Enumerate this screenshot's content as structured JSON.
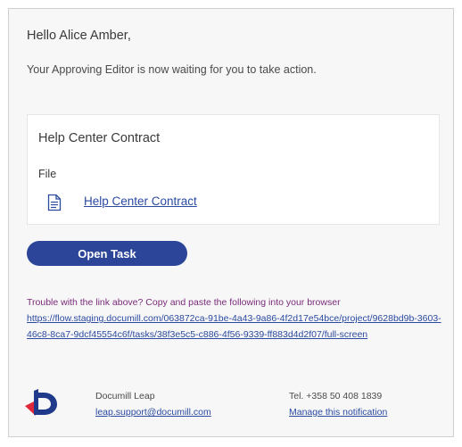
{
  "email": {
    "greeting": "Hello Alice Amber,",
    "message": "Your Approving Editor is now waiting for you to take action.",
    "document": {
      "title": "Help Center Contract",
      "file_label": "File",
      "file_link": "Help Center Contract",
      "file_icon": "document-icon"
    },
    "open_task_label": "Open Task",
    "trouble_text": "Trouble with the link above? Copy and paste the following into your browser",
    "task_url": "https://flow.staging.documill.com/063872ca-91be-4a43-9a86-4f2d17e54bce/project/9628bd9b-3603-46c8-8ca7-9dcf45554c6f/tasks/38f3e5c5-c886-4f56-9339-ff883d4d2f07/full-screen",
    "footer": {
      "company": "Documill Leap",
      "support_email": "leap.support@documill.com",
      "phone": "Tel. +358 50 408 1839",
      "manage_link": "Manage this notification",
      "logo_icon": "documill-logo-icon"
    },
    "colors": {
      "button": "#2c4599",
      "link": "#2a4aa0",
      "trouble_text": "#7a2a7a",
      "logo_navy": "#1f3a8a",
      "logo_red": "#e0283a"
    }
  }
}
